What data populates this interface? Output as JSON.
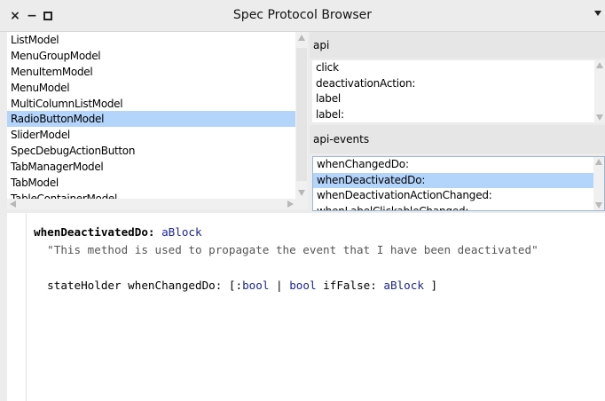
{
  "window": {
    "title": "Spec Protocol Browser",
    "close_glyph": "×",
    "minimize_glyph": "−"
  },
  "class_list": {
    "items": [
      "ListModel",
      "MenuGroupModel",
      "MenuItemModel",
      "MenuModel",
      "MultiColumnListModel",
      "RadioButtonModel",
      "SliderModel",
      "SpecDebugActionButton",
      "TabManagerModel",
      "TabModel",
      "TableContainerModel"
    ],
    "selected": "RadioButtonModel"
  },
  "api_protocol": {
    "header": "api",
    "methods": [
      "click",
      "deactivationAction:",
      "label",
      "label:"
    ]
  },
  "api_events_protocol": {
    "header": "api-events",
    "methods": [
      "whenChangedDo:",
      "whenDeactivatedDo:",
      "whenDeactivationActionChanged:",
      "whenLabelClickableChanged:"
    ],
    "selected": "whenDeactivatedDo:"
  },
  "source": {
    "selector": "whenDeactivatedDo:",
    "argument": "aBlock",
    "comment": "\"This method is used to propagate the event that I have been deactivated\"",
    "line_receiver": "stateHolder",
    "line_message": "whenChangedDo:",
    "line_block_open": "[:",
    "line_block_arg": "bool",
    "line_bar": "|",
    "line_bool": "bool",
    "line_if_false": "ifFalse:",
    "line_arg": "aBlock",
    "line_block_close": "]"
  },
  "colors": {
    "selection": "#b3d4fb",
    "argument": "#1c2591",
    "comment": "#555555"
  }
}
